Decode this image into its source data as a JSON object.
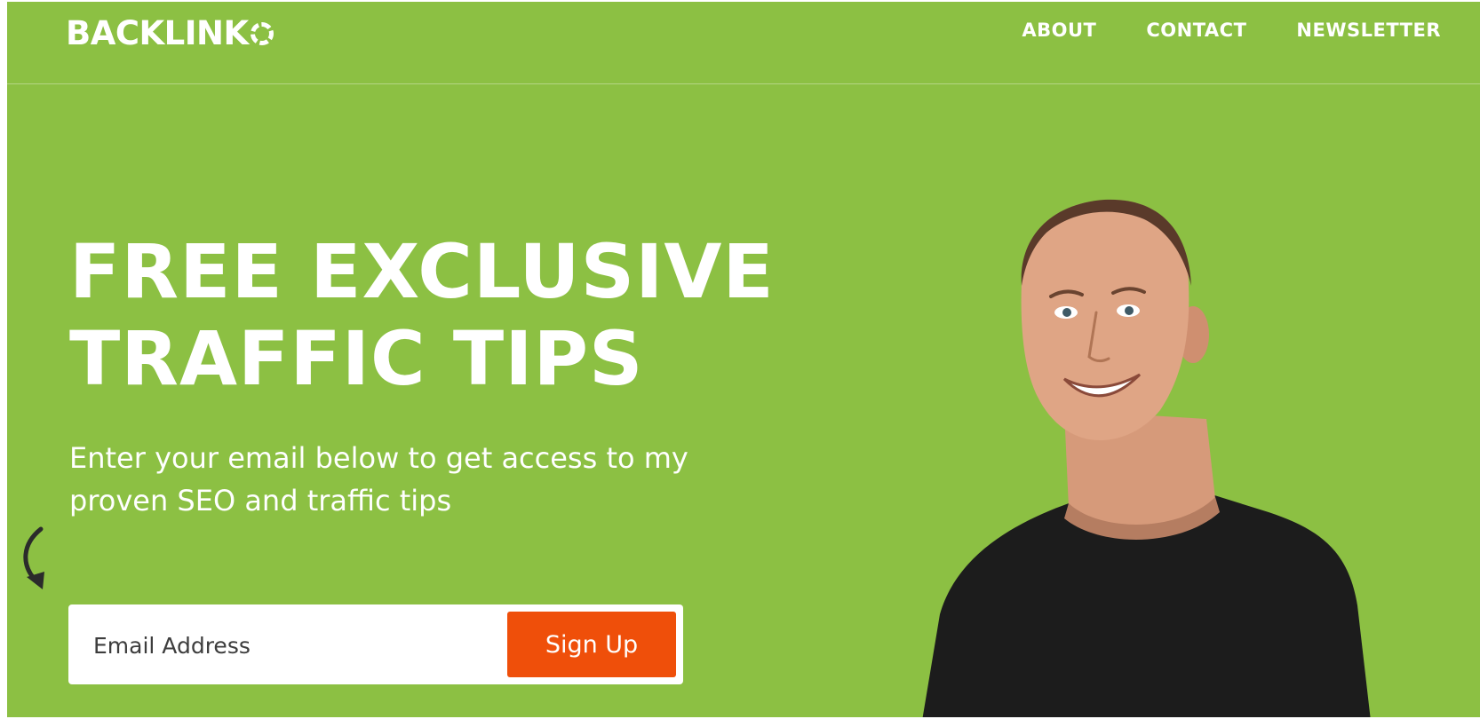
{
  "brand": {
    "logo_text": "BACKLINK",
    "logo_mark": "circle-o-icon"
  },
  "nav": {
    "items": [
      {
        "label": "ABOUT"
      },
      {
        "label": "CONTACT"
      },
      {
        "label": "NEWSLETTER"
      }
    ]
  },
  "hero": {
    "headline_line1": "FREE EXCLUSIVE",
    "headline_line2": "TRAFFIC TIPS",
    "subtext_line1": "Enter your email below to get access to my",
    "subtext_line2": "proven SEO and traffic tips"
  },
  "form": {
    "email_placeholder": "Email Address",
    "email_value": "",
    "signup_label": "Sign Up"
  },
  "colors": {
    "background": "#8cc043",
    "accent": "#ef4f0a",
    "text": "#ffffff"
  }
}
